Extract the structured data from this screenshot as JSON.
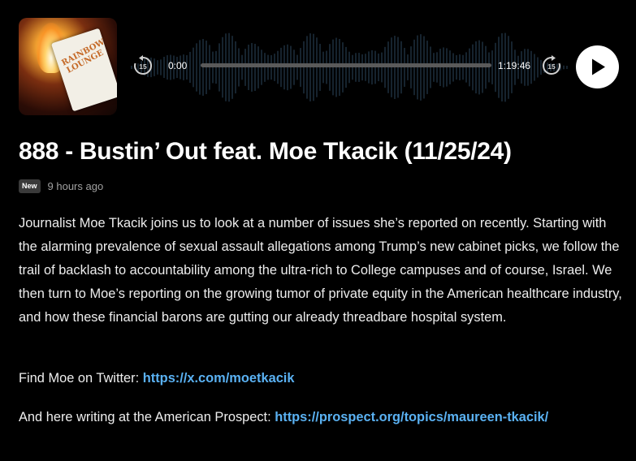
{
  "player": {
    "artwork_text": "RAINBOW LOUNGE",
    "current_time": "0:00",
    "duration": "1:19:46",
    "skip_back_label": "15",
    "skip_forward_label": "15",
    "progress": 0,
    "colors": {
      "track": "#5a5a5a",
      "accent": "#ffffff"
    }
  },
  "episode": {
    "title": "888 - Bustin’ Out feat. Moe Tkacik (11/25/24)",
    "badge": "New",
    "posted": "9 hours ago",
    "description": "Journalist Moe Tkacik joins us to look at a number of issues she’s reported on recently. Starting with the alarming prevalence of sexual assault allegations among Trump’s new cabinet picks, we follow the trail of backlash to accountability among the ultra-rich to College campuses and of course, Israel. We then turn to Moe’s reporting on the growing tumor of private equity in the American healthcare industry, and how these financial barons are gutting our already threadbare hospital system.",
    "twitter_prefix": "Find Moe on Twitter: ",
    "twitter_link": "https://x.com/moetkacik",
    "prospect_prefix": "And here writing at the American Prospect: ",
    "prospect_link": "https://prospect.org/topics/maureen-tkacik/",
    "link_color": "#5ab1f2"
  }
}
